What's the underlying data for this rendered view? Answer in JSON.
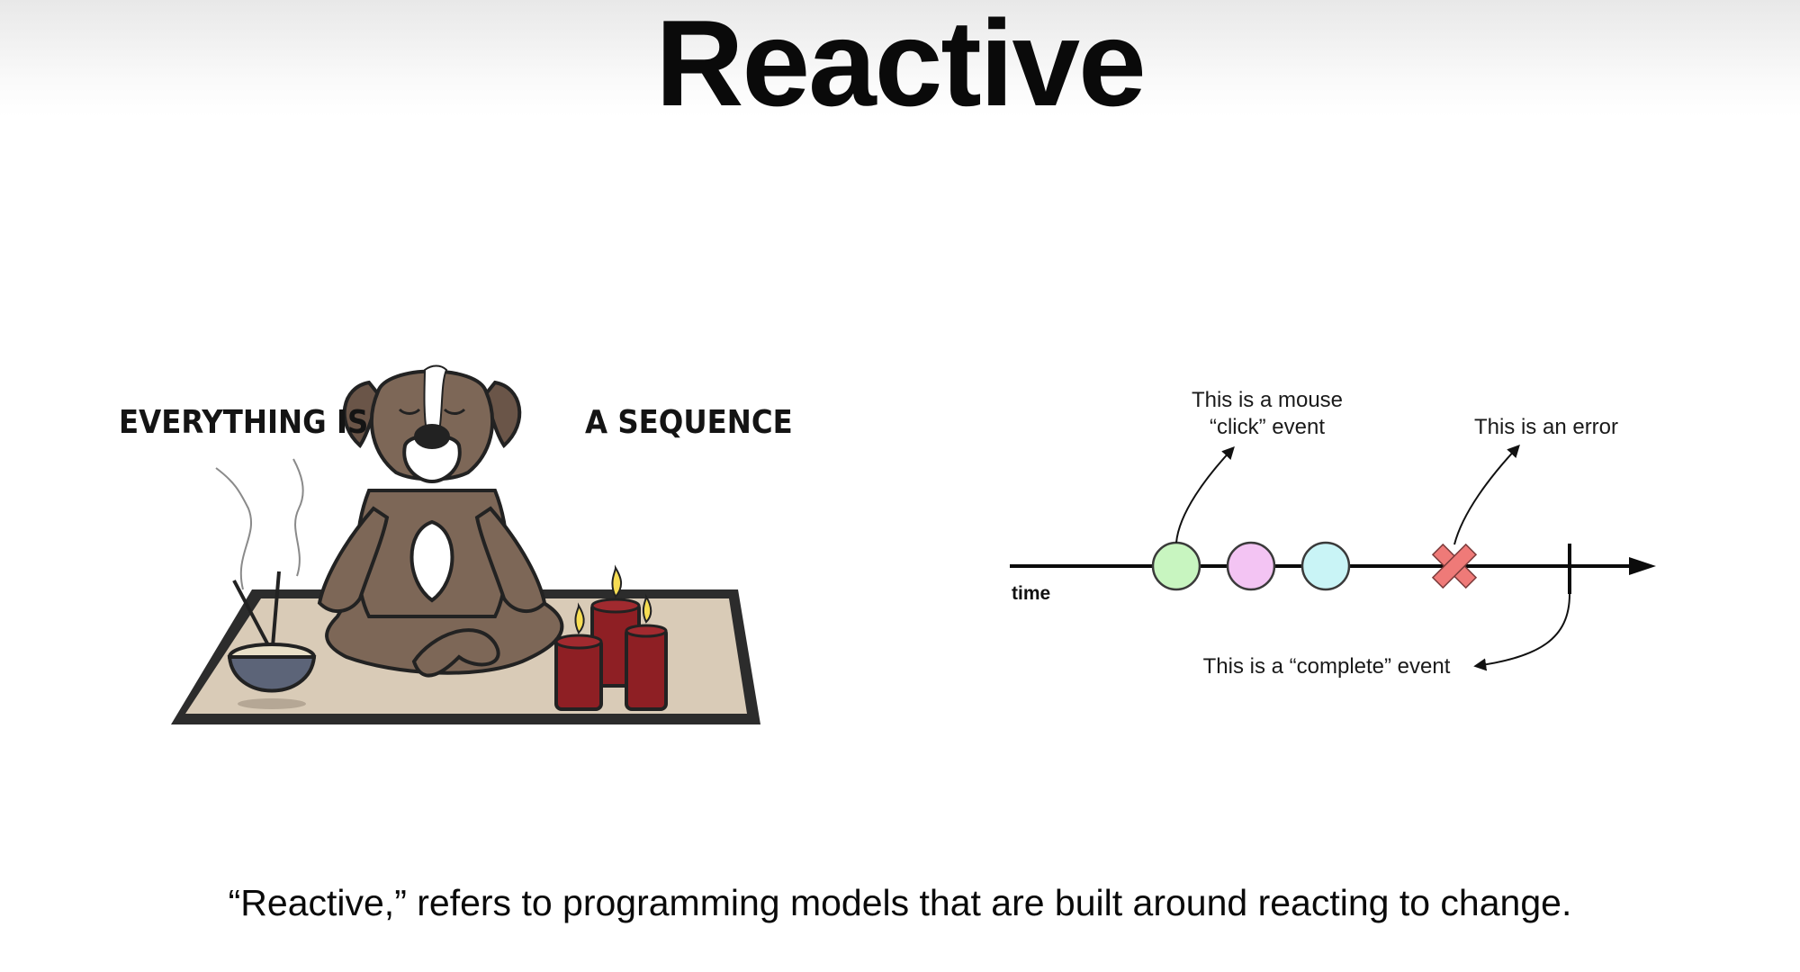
{
  "slide": {
    "title": "Reactive",
    "caption": "“Reactive,” refers to programming models that are built around reacting to change."
  },
  "illustration": {
    "left_text": "EVERYTHING IS",
    "right_text": "A SEQUENCE"
  },
  "marble_diagram": {
    "axis_label": "time",
    "click_annotation_line1": "This is a mouse",
    "click_annotation_line2": "“click” event",
    "error_annotation": "This is an error",
    "complete_annotation": "This is a “complete” event",
    "event_colors": [
      "#c8f5c0",
      "#f3c4f3",
      "#c9f4f6"
    ],
    "error_color": "#ef7a78"
  }
}
